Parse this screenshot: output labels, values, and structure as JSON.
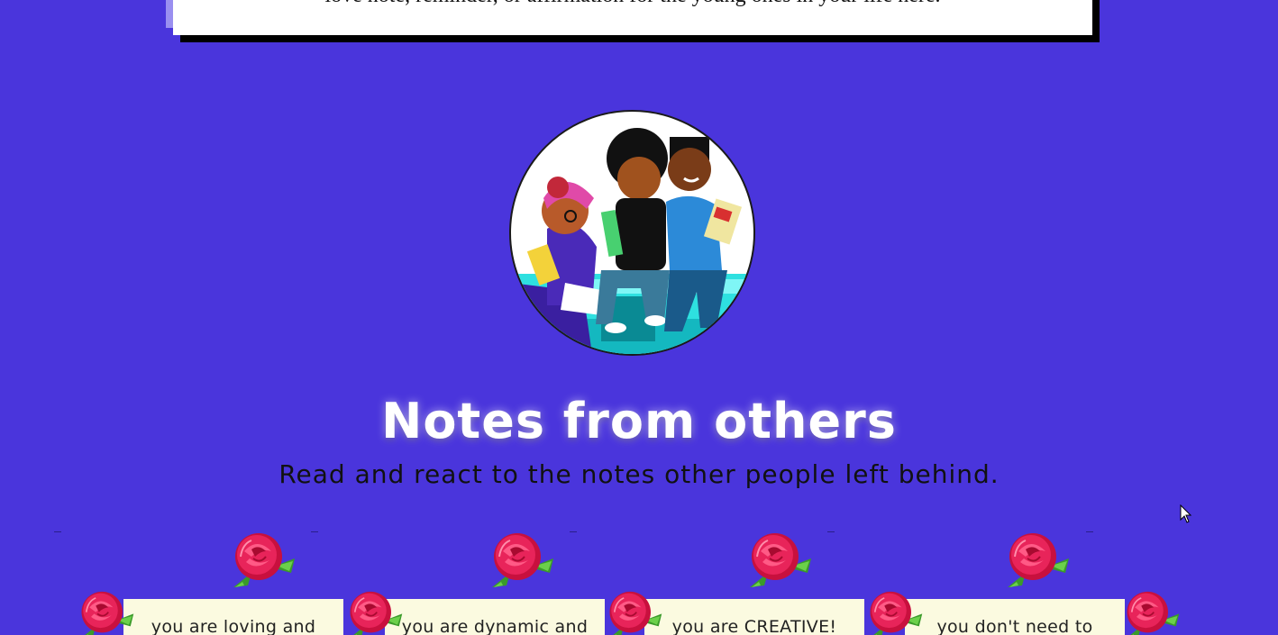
{
  "top_card": {
    "text": "love note, reminder, or affirmation for the young ones in your life here."
  },
  "section": {
    "title": "Notes from others",
    "subtitle": "Read and react to the notes other people left behind."
  },
  "notes": [
    {
      "text": "you are loving and"
    },
    {
      "text": "you are dynamic and"
    },
    {
      "text": "you are CREATIVE!"
    },
    {
      "text": "you don't need to"
    }
  ],
  "icons": {
    "avatar": "illustration-kids-reading-icon",
    "rose": "rose-icon",
    "cursor": "mouse-cursor-icon"
  },
  "colors": {
    "background": "#4a35dc",
    "note_card": "#fbfae0",
    "rose": "#e8245a",
    "leaf": "#3a9a2a"
  }
}
